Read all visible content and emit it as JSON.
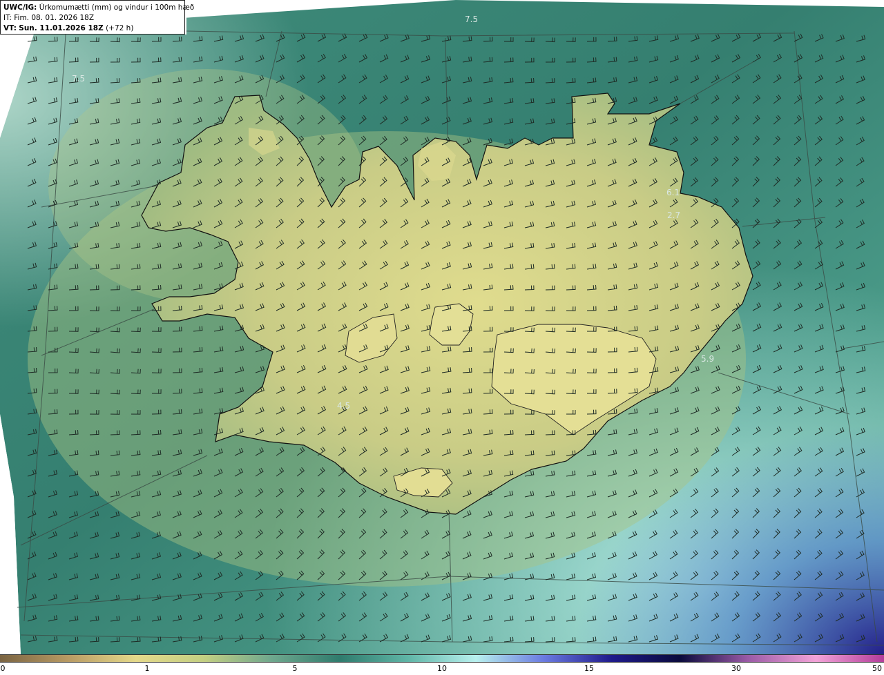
{
  "header": {
    "model": "UWC/IG:",
    "title": "Úrkomumætti (mm) og vindur i 100m hæð",
    "it_label": "IT:",
    "it_value": "Fim. 08. 01. 2026 18Z",
    "vt_label": "VT:",
    "vt_value": "Sun. 11.01.2026 18Z",
    "vt_offset": "(+72 h)"
  },
  "map_labels": [
    {
      "text": "7.5"
    },
    {
      "text": "7.5"
    },
    {
      "text": "6.1"
    },
    {
      "text": "2.7"
    },
    {
      "text": "5.9"
    },
    {
      "text": "4.5"
    }
  ],
  "colorbar": {
    "ticks": [
      "0",
      "1",
      "5",
      "10",
      "15",
      "30",
      "50"
    ],
    "colors": [
      "#7a6442",
      "#b89a63",
      "#e4d98a",
      "#c3cf82",
      "#6ea78d",
      "#2f7b6d",
      "#5fb5a6",
      "#b8f0ee",
      "#6a7ae0",
      "#1e1a8a",
      "#0a0a3c",
      "#9a5aa6",
      "#f3a3d8",
      "#b23c9a"
    ]
  },
  "colors": {
    "sea_deep": "#2f7a6d",
    "sea_mid": "#4c9584",
    "land_low": "#8fb27c",
    "land_high": "#dcd98c",
    "coast": "#111111",
    "wind_barb": "#1e2b25"
  }
}
